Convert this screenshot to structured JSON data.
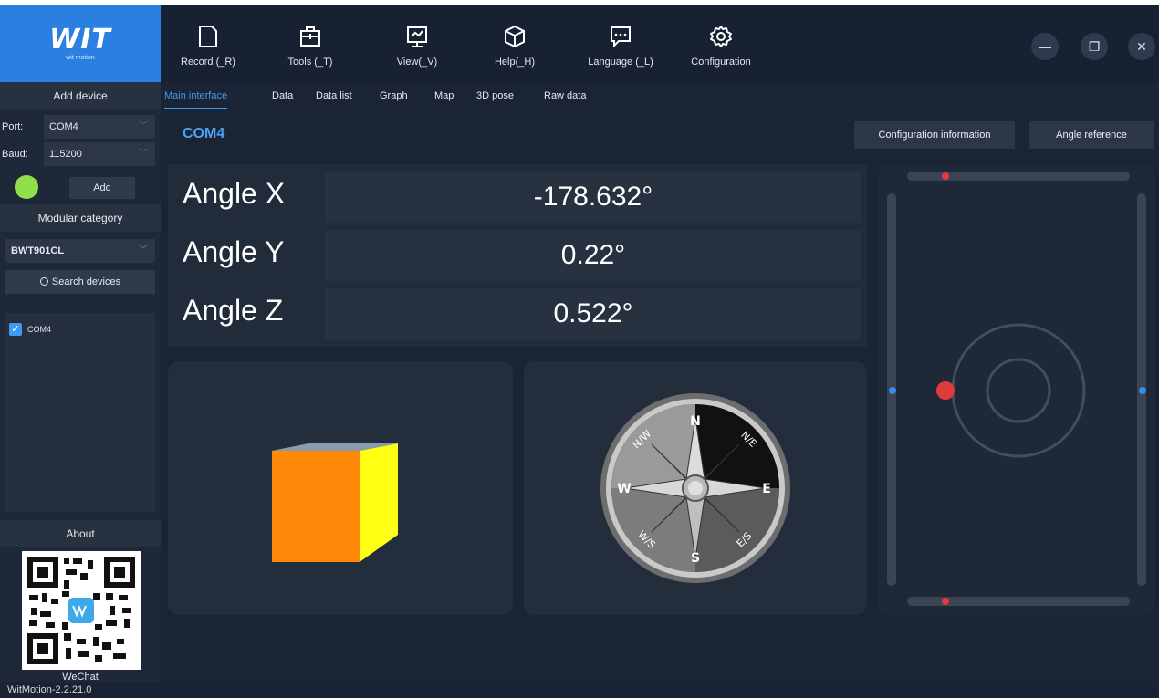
{
  "app": {
    "logo_text": "WIT",
    "logo_sub": "wit motion",
    "version": "WitMotion-2.2.21.0"
  },
  "toolbar": {
    "items": [
      {
        "label": "Record (_R)",
        "icon": "record-icon"
      },
      {
        "label": "Tools (_T)",
        "icon": "tools-icon"
      },
      {
        "label": "View(_V)",
        "icon": "view-icon"
      },
      {
        "label": "Help(_H)",
        "icon": "help-icon"
      },
      {
        "label": "Language (_L)",
        "icon": "language-icon"
      },
      {
        "label": "Configuration",
        "icon": "gear-icon"
      }
    ],
    "window_buttons": [
      "—",
      "❐",
      "✕"
    ]
  },
  "sidebar": {
    "add_device": "Add device",
    "port_label": "Port:",
    "port_value": "COM4",
    "baud_label": "Baud:",
    "baud_value": "115200",
    "status_color": "#8fe04a",
    "add_button": "Add",
    "modular_category": "Modular category",
    "category_value": "BWT901CL",
    "search_button": "Search devices",
    "devices": [
      {
        "name": "COM4",
        "checked": true
      }
    ],
    "about": "About",
    "wechat": "WeChat"
  },
  "tabs": [
    "Main interface",
    "Data",
    "Data list",
    "Graph",
    "Map",
    "3D pose",
    "Raw data"
  ],
  "active_tab": "Main interface",
  "main": {
    "title": "COM4",
    "config_button": "Configuration information",
    "angle_ref_button": "Angle reference",
    "angles": [
      {
        "label": "Angle X",
        "value": "-178.632°"
      },
      {
        "label": "Angle Y",
        "value": "0.22°"
      },
      {
        "label": "Angle Z",
        "value": "0.522°"
      }
    ]
  },
  "compass": {
    "n": "N",
    "s": "S",
    "e": "E",
    "w": "W",
    "nw": "N/W",
    "ne": "N/E",
    "sw": "W/S",
    "se": "E/S"
  },
  "colors": {
    "accent": "#3e9bf2",
    "brand": "#2a7fe0",
    "indicator_red": "#e03a3f",
    "indicator_blue": "#3a8bef"
  }
}
